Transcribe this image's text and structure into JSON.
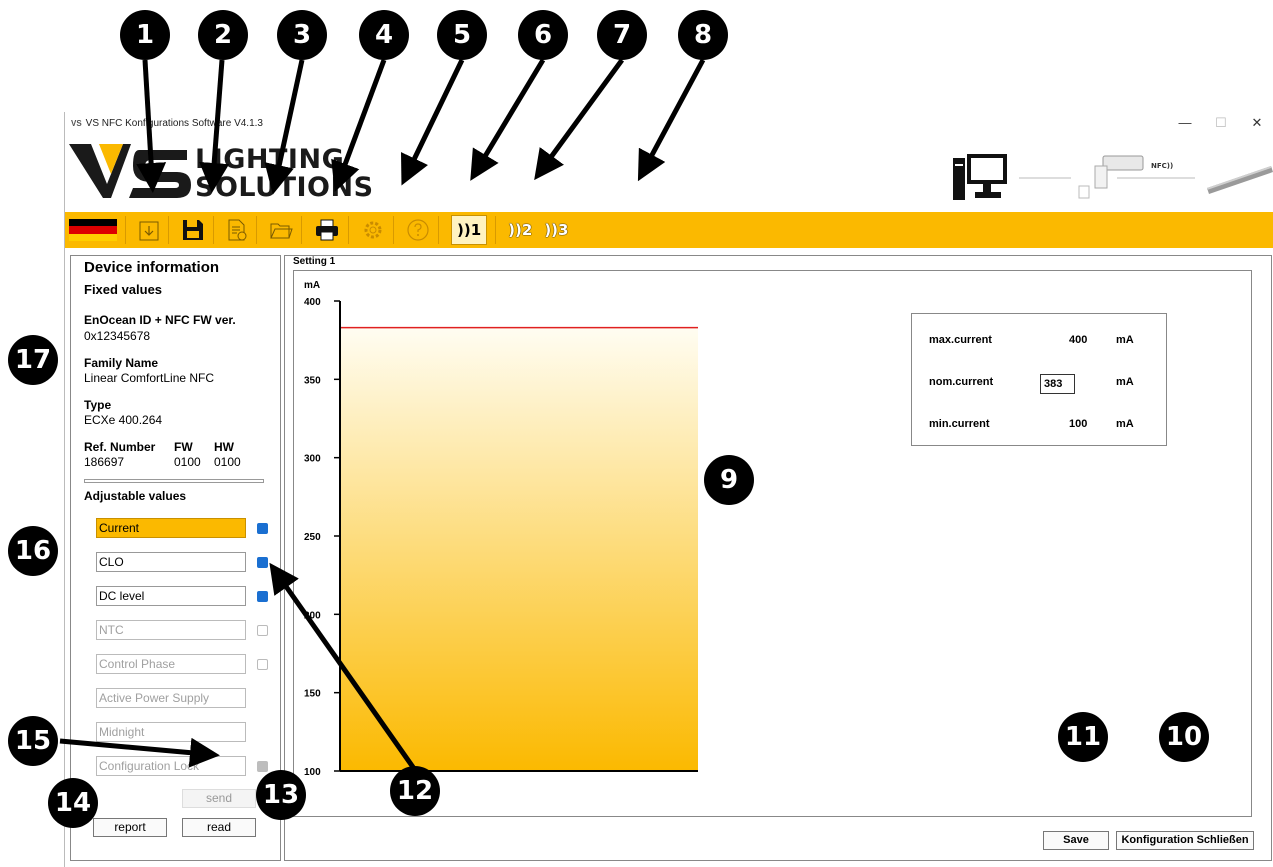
{
  "window": {
    "title": "VS NFC Konfigurations Software V4.1.3",
    "app_icon": "VS",
    "minimize": "—",
    "maximize": "☐",
    "close": "✕"
  },
  "logo": {
    "line1": "LIGHTING",
    "line2": "SOLUTIONS"
  },
  "header_devices": {
    "nfc_label": "NFC))"
  },
  "toolbar": {
    "items": [
      {
        "name": "language-flag",
        "icon": "flag-de"
      },
      {
        "name": "import",
        "icon": "download-icon"
      },
      {
        "name": "save",
        "icon": "floppy-icon"
      },
      {
        "name": "new-file",
        "icon": "new-document-icon"
      },
      {
        "name": "open",
        "icon": "folder-icon"
      },
      {
        "name": "print",
        "icon": "printer-icon"
      },
      {
        "name": "settings",
        "icon": "gear-icon"
      },
      {
        "name": "help",
        "icon": "help-icon"
      }
    ],
    "nfc1": "))1",
    "nfc2": "))2",
    "nfc3": "))3",
    "accent": "#fbb900"
  },
  "device_info": {
    "title": "Device information",
    "fixed_title": "Fixed values",
    "enocean_label": "EnOcean ID + NFC FW ver.",
    "enocean_value": "0x12345678",
    "family_label": "Family Name",
    "family_value": "Linear ComfortLine NFC",
    "type_label": "Type",
    "type_value": "ECXe 400.264",
    "ref_label": "Ref. Number",
    "ref_value": "186697",
    "fw_label": "FW",
    "fw_value": "0100",
    "hw_label": "HW",
    "hw_value": "0100",
    "adjustable_title": "Adjustable values",
    "adjustable": [
      {
        "label": "Current",
        "state": "selected",
        "checked": true
      },
      {
        "label": "CLO",
        "state": "enabled",
        "checked": true
      },
      {
        "label": "DC level",
        "state": "enabled",
        "checked": true
      },
      {
        "label": "NTC",
        "state": "disabled",
        "checked": false
      },
      {
        "label": "Control Phase",
        "state": "disabled",
        "checked": false
      },
      {
        "label": "Active Power Supply",
        "state": "disabled",
        "checked": null
      },
      {
        "label": "Midnight",
        "state": "disabled",
        "checked": null
      },
      {
        "label": "Configuration Lock",
        "state": "disabled",
        "checked": true
      }
    ],
    "send_label": "send",
    "report_label": "report",
    "read_label": "read"
  },
  "setting": {
    "label": "Setting 1",
    "save_label": "Save",
    "close_label": "Konfiguration Schließen",
    "max_label": "max.current",
    "max_value": "400",
    "max_unit": "mA",
    "nom_label": "nom.current",
    "nom_value": "383",
    "nom_unit": "mA",
    "min_label": "min.current",
    "min_value": "100",
    "min_unit": "mA"
  },
  "chart_data": {
    "type": "bar",
    "ylabel": "mA",
    "yticks": [
      "400",
      "350",
      "300",
      "250",
      "200",
      "150",
      "100"
    ],
    "ylim": [
      100,
      400
    ],
    "values": [
      383
    ],
    "fill_top_color": "#fffdf2",
    "fill_bottom_color": "#fbb900",
    "line_color": "#e02020"
  },
  "callouts": [
    "1",
    "2",
    "3",
    "4",
    "5",
    "6",
    "7",
    "8",
    "9",
    "10",
    "11",
    "12",
    "13",
    "14",
    "15",
    "16",
    "17"
  ]
}
